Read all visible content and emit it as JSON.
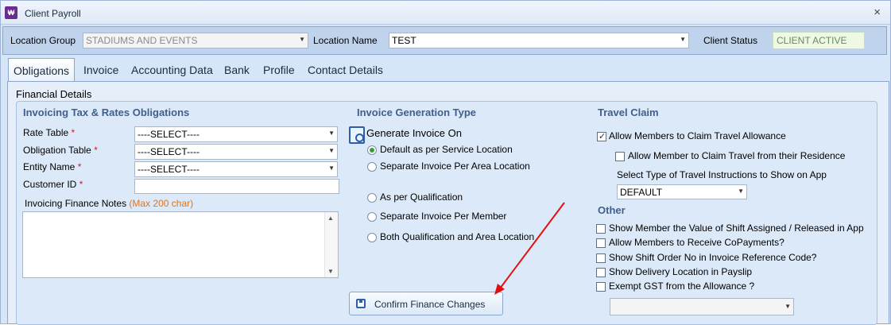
{
  "window": {
    "title": "Client Payroll",
    "icon": "payroll-app-icon",
    "close": "×"
  },
  "header": {
    "location_group_label": "Location Group",
    "location_group_value": "STADIUMS AND EVENTS",
    "location_name_label": "Location Name",
    "location_name_value": "TEST",
    "client_status_label": "Client Status",
    "client_status_value": "CLIENT ACTIVE"
  },
  "tabs": [
    "Obligations",
    "Invoice",
    "Accounting Data",
    "Bank",
    "Profile",
    "Contact Details"
  ],
  "active_tab": "Obligations",
  "section_title": "Financial Details",
  "invoicing": {
    "title": "Invoicing Tax & Rates Obligations",
    "rate_table_label": "Rate Table",
    "rate_table_value": "----SELECT----",
    "obligation_table_label": "Obligation Table",
    "obligation_table_value": "----SELECT----",
    "entity_name_label": "Entity Name",
    "entity_name_value": "----SELECT----",
    "customer_id_label": "Customer ID",
    "customer_id_value": "",
    "notes_label": "Invoicing Finance Notes",
    "notes_hint": "(Max 200 char)",
    "notes_value": "",
    "required_mark": "*"
  },
  "generation": {
    "title": "Invoice Generation Type",
    "subtitle": "Generate Invoice On",
    "options": [
      {
        "label": "Default as per Service Location",
        "selected": true
      },
      {
        "label": "Separate Invoice Per Area Location",
        "selected": false
      },
      {
        "label": "As per Qualification",
        "selected": false
      },
      {
        "label": "Separate Invoice Per Member",
        "selected": false
      },
      {
        "label": "Both Qualification and Area Location",
        "selected": false
      }
    ],
    "confirm_button": "Confirm Finance Changes"
  },
  "travel": {
    "title": "Travel Claim",
    "allow_travel": {
      "label": "Allow Members to Claim Travel Allowance",
      "checked": true
    },
    "allow_residence": {
      "label": "Allow Member to Claim Travel from their Residence",
      "checked": false
    },
    "instructions_label": "Select Type of Travel Instructions to Show on App",
    "instructions_value": "DEFAULT"
  },
  "other": {
    "title": "Other",
    "options": [
      {
        "label": "Show Member the Value of Shift Assigned / Released in App",
        "checked": false
      },
      {
        "label": "Allow Members to Receive CoPayments?",
        "checked": false
      },
      {
        "label": "Show Shift Order No in Invoice Reference Code?",
        "checked": false
      },
      {
        "label": "Show Delivery Location in Payslip",
        "checked": false
      },
      {
        "label": "Exempt GST from the Allowance ?",
        "checked": false
      }
    ],
    "gst_select_value": ""
  },
  "colors": {
    "accent": "#3f5f8c",
    "required": "#d02020",
    "hint": "#e0751c",
    "annotation_arrow": "#e01010"
  }
}
